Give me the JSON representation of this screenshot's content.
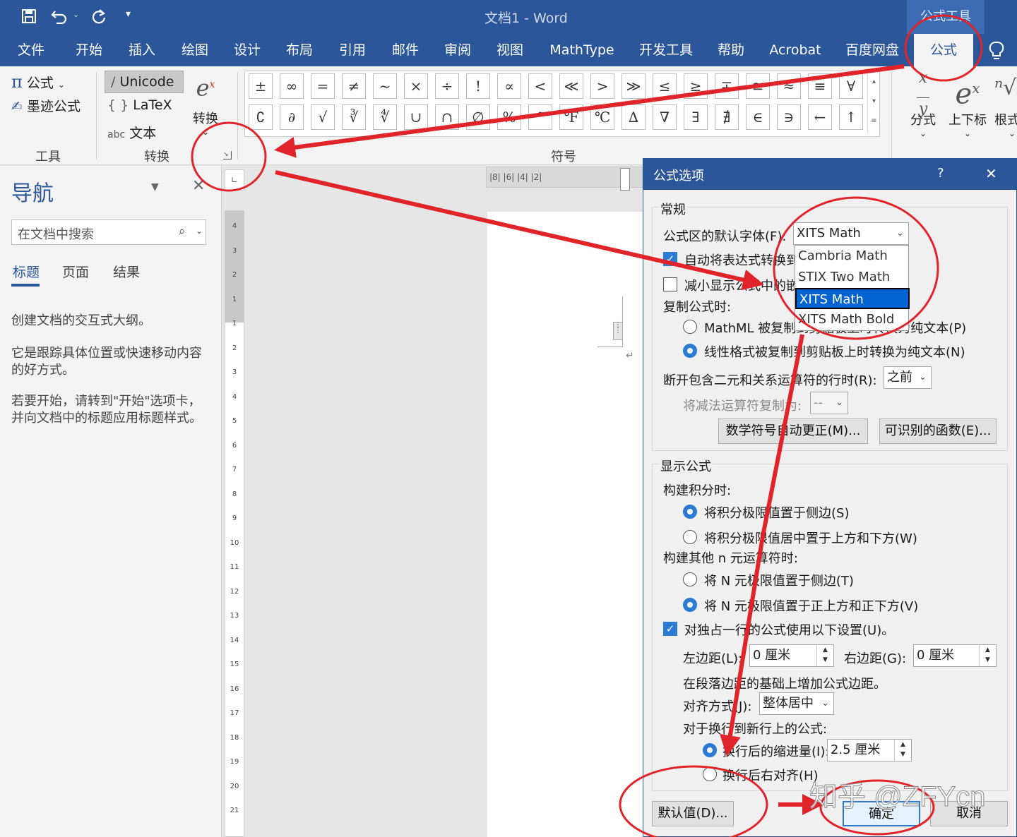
{
  "titlebar": {
    "title": "文档1  -  Word",
    "context_tab": "公式工具",
    "qat": [
      "save-icon",
      "undo-icon",
      "redo-icon",
      "customize-icon"
    ]
  },
  "tabs": [
    "文件",
    "开始",
    "插入",
    "绘图",
    "设计",
    "布局",
    "引用",
    "邮件",
    "审阅",
    "视图",
    "MathType",
    "开发工具",
    "帮助",
    "Acrobat",
    "百度网盘",
    "公式"
  ],
  "ribbon": {
    "tools": {
      "formula": "公式",
      "ink": "墨迹公式",
      "label": "工具"
    },
    "convert": {
      "unicode": "Unicode",
      "latex": "LaTeX",
      "text": "文本",
      "convert_btn": "转换",
      "label": "转换"
    },
    "symbols": {
      "label": "符号",
      "row1": [
        "±",
        "∞",
        "=",
        "≠",
        "~",
        "×",
        "÷",
        "!",
        "∝",
        "<",
        "≪",
        ">",
        "≫",
        "≤",
        "≥",
        "∓",
        "≅",
        "≈",
        "≡",
        "∀"
      ],
      "row2": [
        "∁",
        "∂",
        "√",
        "∛",
        "∜",
        "∪",
        "∩",
        "∅",
        "%",
        "°",
        "℉",
        "℃",
        "∆",
        "∇",
        "∃",
        "∄",
        "∈",
        "∋",
        "←",
        "↑"
      ]
    },
    "structures": {
      "fraction": "分式",
      "script": "上下标",
      "radical": "根式"
    }
  },
  "nav": {
    "title": "导航",
    "search_placeholder": "在文档中搜索",
    "tabs": [
      "标题",
      "页面",
      "结果"
    ],
    "p1": "创建文档的交互式大纲。",
    "p2": "它是跟踪具体位置或快速移动内容的好方式。",
    "p3": "若要开始，请转到\"开始\"选项卡，并向文档中的标题应用标题样式。"
  },
  "ruler_h": "|8|  |6|  |4|  |2|",
  "ruler_v": [
    "4",
    "3",
    "2",
    "1",
    "1",
    "2",
    "3",
    "4",
    "5",
    "6",
    "7",
    "8",
    "9",
    "10",
    "11",
    "12",
    "13",
    "14",
    "15",
    "16",
    "17",
    "18",
    "19",
    "20",
    "21"
  ],
  "dialog": {
    "title": "公式选项",
    "help": "?",
    "close": "✕",
    "general": {
      "heading": "常规",
      "font_label": "公式区的默认字体(F):",
      "font_value": "XITS Math",
      "font_options": [
        "Cambria Math",
        "STIX Two Math",
        "XITS Math",
        "XITS Math Bold"
      ],
      "auto_convert": "自动将表达式转换到",
      "reduce": "减小显示公式中的嵌",
      "copy_heading": "复制公式时:",
      "copy_mathml": "MathML 被复制到剪贴板上时转换为纯文本(P)",
      "copy_linear": "线性格式被复制到剪贴板上时转换为纯文本(N)",
      "break_label": "断开包含二元和关系运算符的行时(R):",
      "break_value": "之前",
      "minus_label": "将减法运算符复制为:",
      "minus_value": "--",
      "autocorrect_btn": "数学符号自动更正(M)...",
      "functions_btn": "可识别的函数(E)..."
    },
    "display": {
      "heading": "显示公式",
      "integral_heading": "构建积分时:",
      "integral_side": "将积分极限值置于侧边(S)",
      "integral_center": "将积分极限值居中置于上方和下方(W)",
      "nary_heading": "构建其他 n 元运算符时:",
      "nary_side": "将 N 元极限值置于侧边(T)",
      "nary_center": "将 N 元极限值置于正上方和正下方(V)",
      "own_line": "对独占一行的公式使用以下设置(U)。",
      "left_margin_label": "左边距(L):",
      "left_margin_value": "0 厘米",
      "right_margin_label": "右边距(G):",
      "right_margin_value": "0 厘米",
      "margin_note": "在段落边距的基础上增加公式边距。",
      "align_label": "对齐方式(J):",
      "align_value": "整体居中",
      "wrap_heading": "对于换行到新行上的公式:",
      "indent_label": "换行后的缩进量(I):",
      "indent_value": "2.5 厘米",
      "right_align": "换行后右对齐(H)"
    },
    "buttons": {
      "default": "默认值(D)...",
      "ok": "确定",
      "cancel": "取消"
    }
  },
  "watermark": "知乎 @ZFYcn",
  "colors": {
    "word_blue": "#2b579a",
    "annotation_red": "#e0242a",
    "select_blue": "#0063d1"
  }
}
